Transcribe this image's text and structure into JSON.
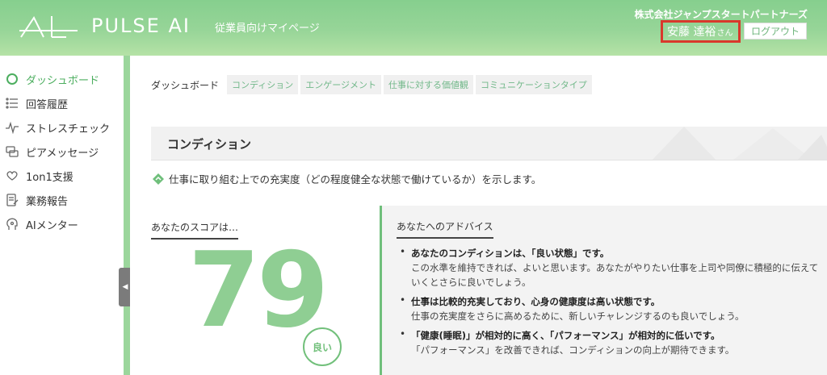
{
  "header": {
    "brand": "PULSE AI",
    "subtitle": "従業員向けマイページ",
    "company": "株式会社ジャンプスタートパートナーズ",
    "user_name": "安藤 達裕",
    "user_suffix": "さん",
    "logout_label": "ログアウト"
  },
  "sidebar": {
    "items": [
      {
        "label": "ダッシュボード",
        "icon": "dashboard-ring-icon",
        "active": true
      },
      {
        "label": "回答履歴",
        "icon": "list-icon"
      },
      {
        "label": "ストレスチェック",
        "icon": "pulse-icon"
      },
      {
        "label": "ピアメッセージ",
        "icon": "message-icon"
      },
      {
        "label": "1on1支援",
        "icon": "heart-hand-icon"
      },
      {
        "label": "業務報告",
        "icon": "report-icon"
      },
      {
        "label": "AIメンター",
        "icon": "mentor-icon"
      }
    ],
    "collapse_label": "◀"
  },
  "main": {
    "breadcrumb_current": "ダッシュボード",
    "tabs": [
      {
        "label": "コンディション"
      },
      {
        "label": "エンゲージメント"
      },
      {
        "label": "仕事に対する価値観"
      },
      {
        "label": "コミュニケーションタイプ"
      }
    ],
    "section_title": "コンディション",
    "description": "仕事に取り組む上での充実度（どの程度健全な状態で働けているか）を示します。",
    "score": {
      "label": "あなたのスコアは…",
      "value": "79",
      "badge": "良い"
    },
    "advice": {
      "title": "あなたへのアドバイス",
      "items": [
        {
          "head": "あなたのコンディションは、「良い状態」です。",
          "body": "この水準を維持できれば、よいと思います。あなたがやりたい仕事を上司や同僚に積極的に伝えていくとさらに良いでしょう。"
        },
        {
          "head": "仕事は比較的充実しており、心身の健康度は高い状態です。",
          "body": "仕事の充実度をさらに高めるために、新しいチャレンジするのも良いでしょう。"
        },
        {
          "head": "「健康(睡眠)」が相対的に高く、「パフォーマンス」が相対的に低いです。",
          "body": "「パフォーマンス」を改善できれば、コンディションの向上が期待できます。"
        }
      ]
    }
  },
  "colors": {
    "accent": "#8fce93",
    "header_green": "#97d598",
    "highlight_red": "#d9382c"
  }
}
